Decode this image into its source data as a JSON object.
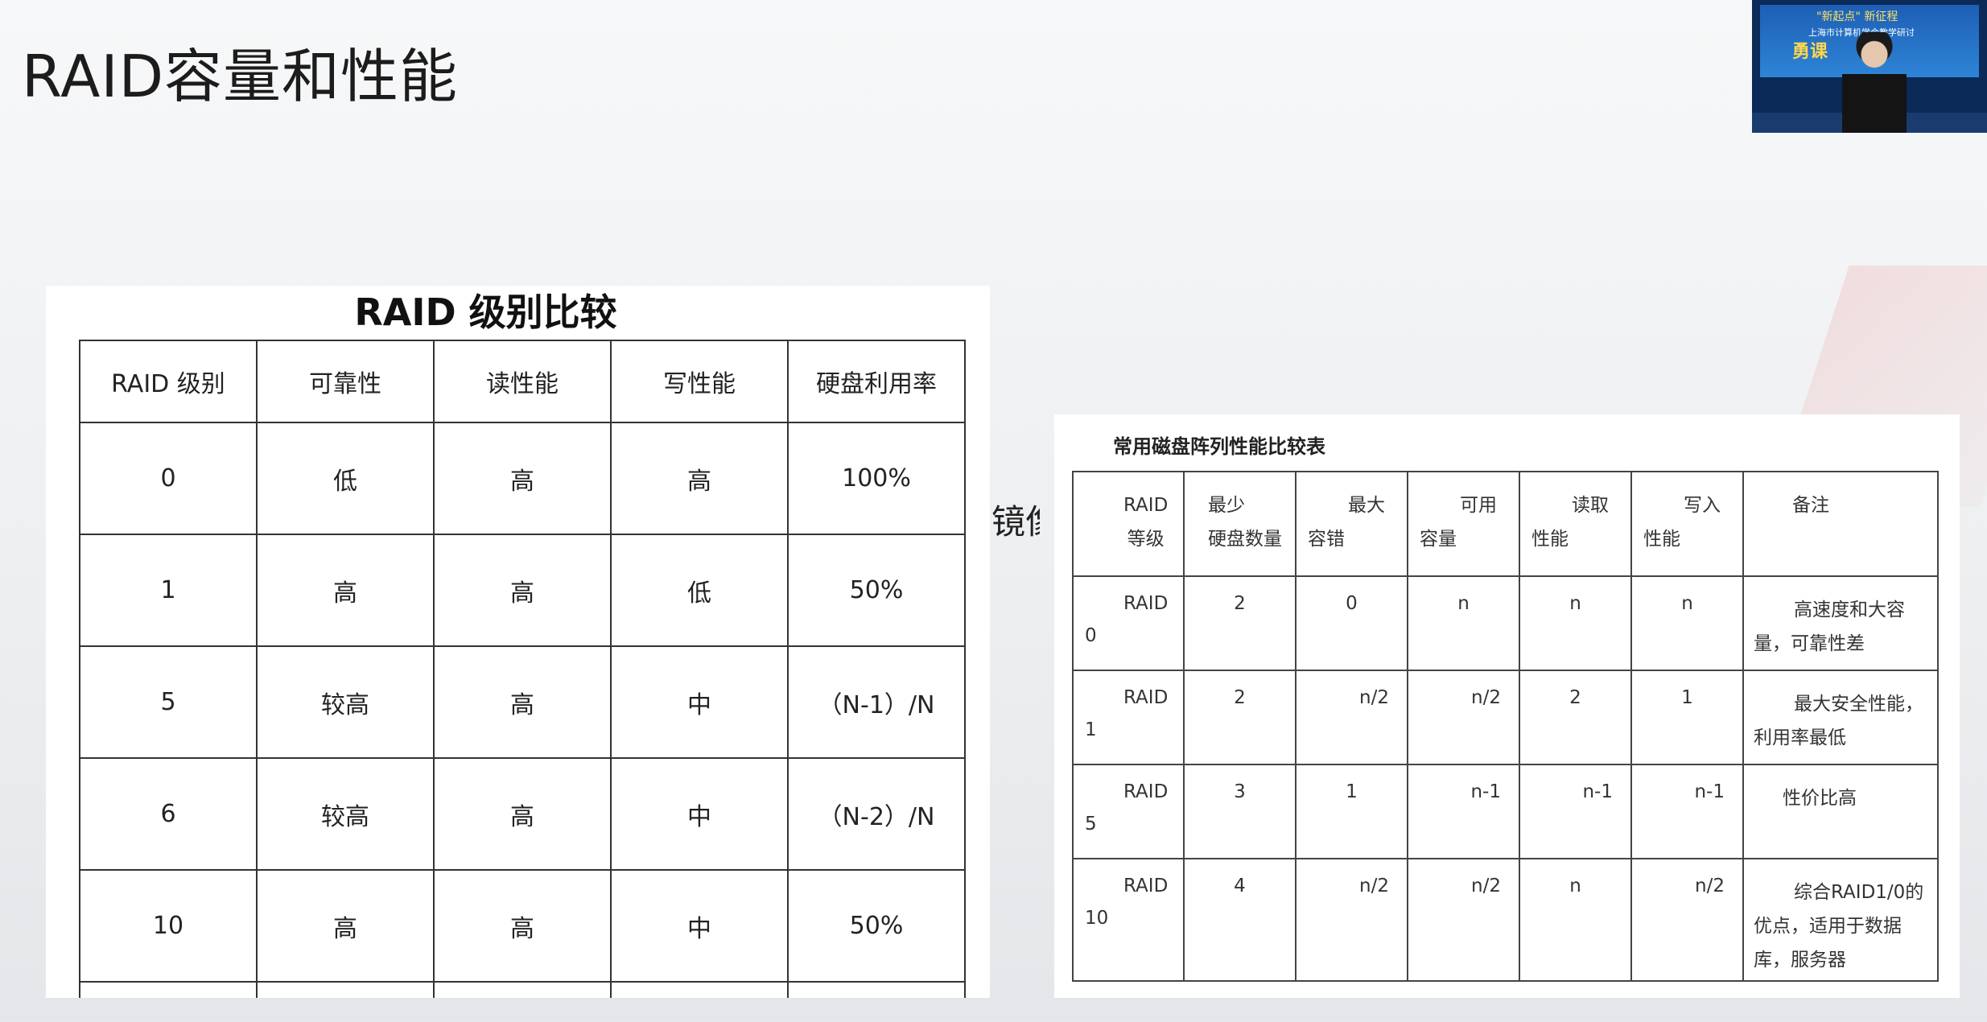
{
  "slide": {
    "title": "RAID容量和性能"
  },
  "camera": {
    "banner_line1": "\"新起点\" 新征程",
    "banner_line2": "上海市计算机学会教学研讨",
    "logo_text": "勇课"
  },
  "left_table": {
    "title": "RAID 级别比较",
    "headers": [
      "RAID 级别",
      "可靠性",
      "读性能",
      "写性能",
      "硬盘利用率"
    ],
    "rows": [
      [
        "0",
        "低",
        "高",
        "高",
        "100%"
      ],
      [
        "1",
        "高",
        "高",
        "低",
        "50%"
      ],
      [
        "5",
        "较高",
        "高",
        "中",
        "（N-1）/N"
      ],
      [
        "6",
        "较高",
        "高",
        "中",
        "（N-2）/N"
      ],
      [
        "10",
        "高",
        "高",
        "中",
        "50%"
      ]
    ]
  },
  "side_fragment": "镜像",
  "right_table": {
    "title": "常用磁盘阵列性能比较表",
    "headers": {
      "level_line1": "RAID",
      "level_line2": "等级",
      "min_disks": [
        "最少",
        "硬盘数量"
      ],
      "fault_tolerance": [
        "最大",
        "容错"
      ],
      "capacity": [
        "可用",
        "容量"
      ],
      "read": [
        "读取",
        "性能"
      ],
      "write": [
        "写入",
        "性能"
      ],
      "note": "备注"
    },
    "rows": [
      {
        "level_a": "RAID",
        "level_b": "0",
        "min": "2",
        "tol": "0",
        "cap": "n",
        "read": "n",
        "write": "n",
        "note": "高速度和大容量，可靠性差"
      },
      {
        "level_a": "RAID",
        "level_b": "1",
        "min": "2",
        "tol": "n/2",
        "cap": "n/2",
        "read": "2",
        "write": "1",
        "note": "最大安全性能，利用率最低"
      },
      {
        "level_a": "RAID",
        "level_b": "5",
        "min": "3",
        "tol": "1",
        "cap": "n-1",
        "read": "n-1",
        "write": "n-1",
        "note": "性价比高"
      },
      {
        "level_a": "RAID",
        "level_b": "10",
        "min": "4",
        "tol": "n/2",
        "cap": "n/2",
        "read": "n",
        "write": "n/2",
        "note": "综合RAID1/0的优点，适用于数据库，服务器"
      }
    ]
  }
}
